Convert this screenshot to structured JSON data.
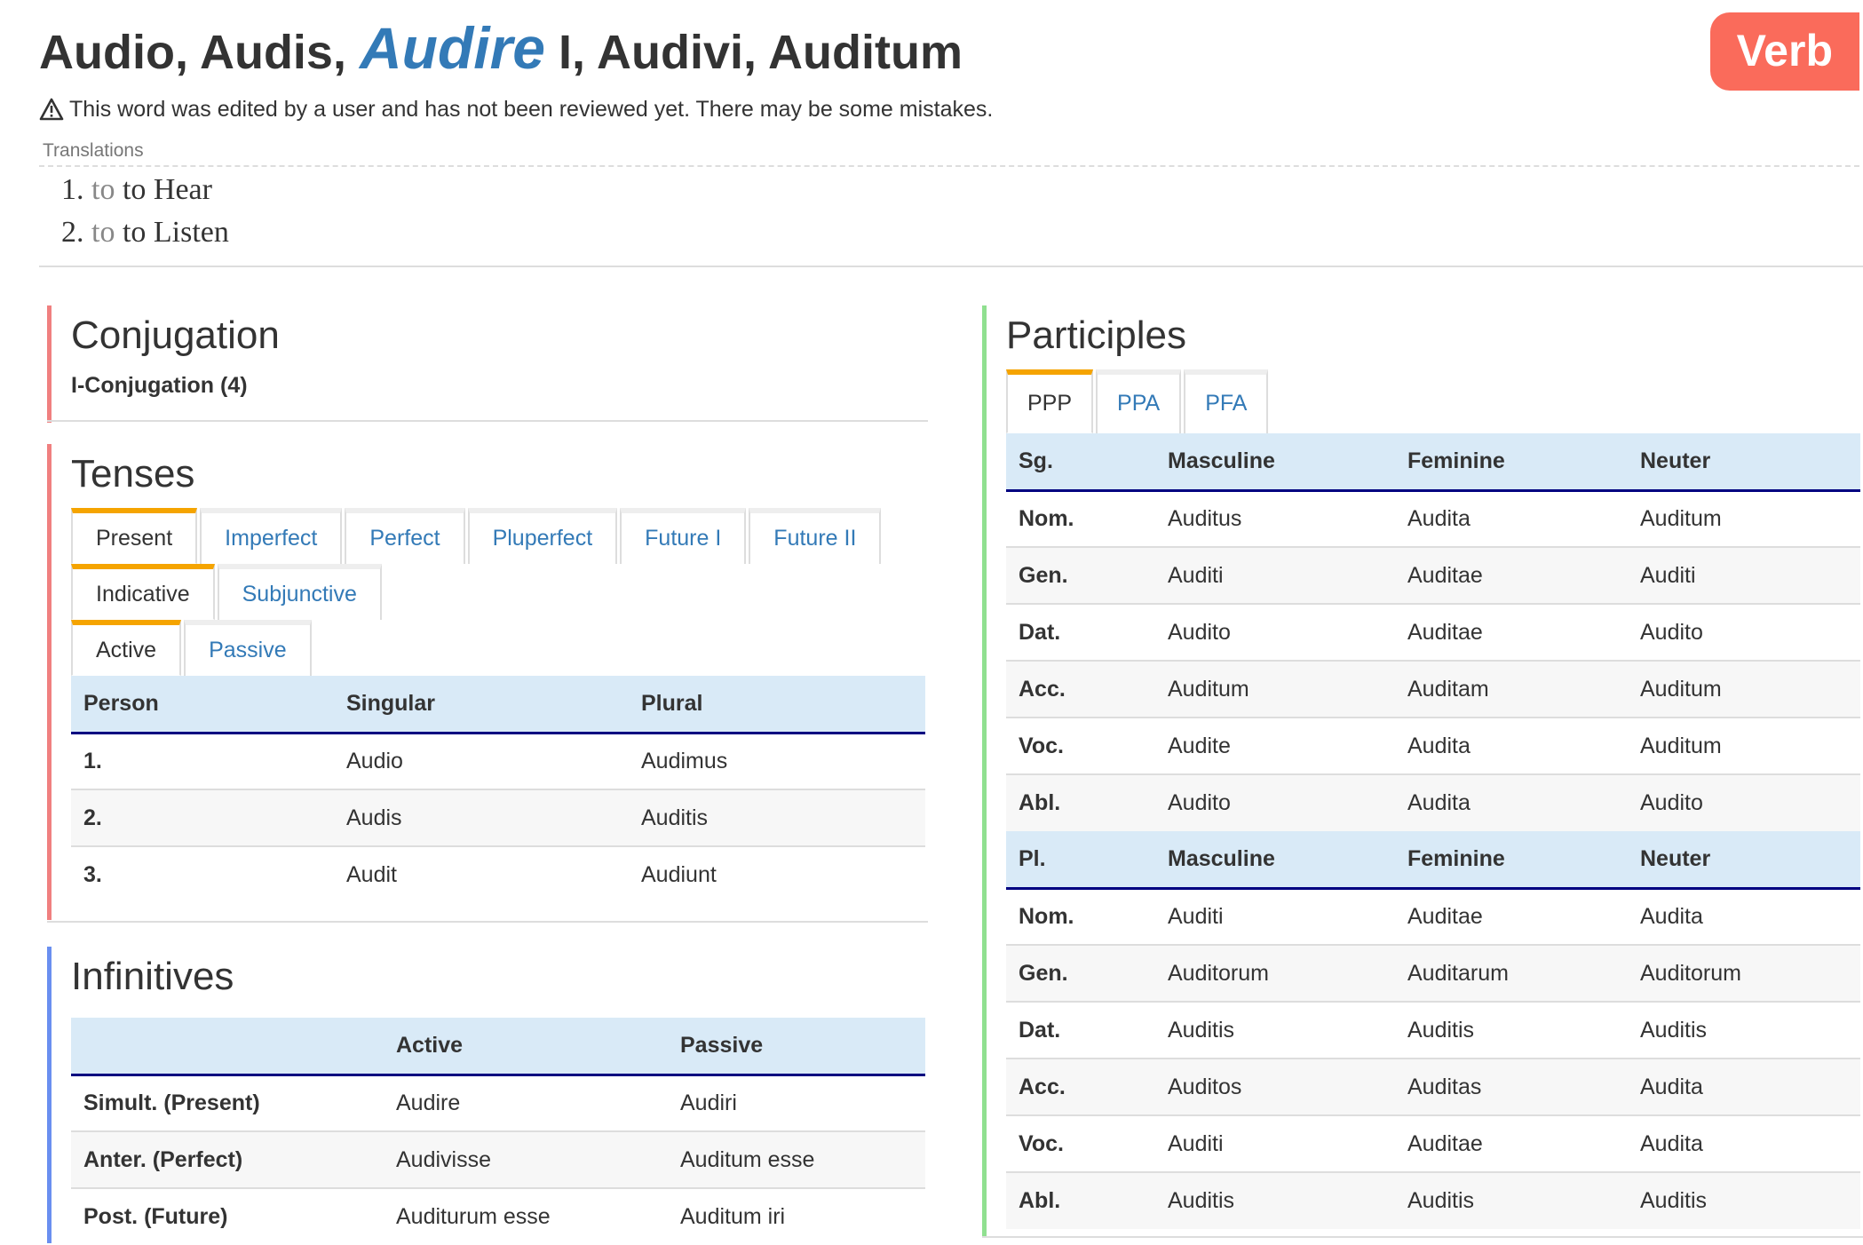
{
  "header": {
    "title_before": "Audio, Audis,",
    "title_highlight": "Audire",
    "title_after": "I, Audivi, Auditum",
    "badge": "Verb",
    "warning": "This word was edited by a user and has not been reviewed yet. There may be some mistakes."
  },
  "translations": {
    "label": "Translations",
    "items": [
      {
        "num": "1.",
        "prefix": "to",
        "text": "to Hear"
      },
      {
        "num": "2.",
        "prefix": "to",
        "text": "to Listen"
      }
    ]
  },
  "conjugation": {
    "heading": "Conjugation",
    "value": "I-Conjugation (4)"
  },
  "tenses": {
    "heading": "Tenses",
    "tense_tabs": [
      "Present",
      "Imperfect",
      "Perfect",
      "Pluperfect",
      "Future I",
      "Future II"
    ],
    "mood_tabs": [
      "Indicative",
      "Subjunctive"
    ],
    "voice_tabs": [
      "Active",
      "Passive"
    ],
    "columns": [
      "Person",
      "Singular",
      "Plural"
    ],
    "rows": [
      [
        "1.",
        "Audio",
        "Audimus"
      ],
      [
        "2.",
        "Audis",
        "Auditis"
      ],
      [
        "3.",
        "Audit",
        "Audiunt"
      ]
    ]
  },
  "infinitives": {
    "heading": "Infinitives",
    "columns": [
      "",
      "Active",
      "Passive"
    ],
    "rows": [
      [
        "Simult. (Present)",
        "Audire",
        "Audiri"
      ],
      [
        "Anter. (Perfect)",
        "Audivisse",
        "Auditum esse"
      ],
      [
        "Post. (Future)",
        "Auditurum esse",
        "Auditum iri"
      ]
    ]
  },
  "participles": {
    "heading": "Participles",
    "tabs": [
      "PPP",
      "PPA",
      "PFA"
    ],
    "singular_header": [
      "Sg.",
      "Masculine",
      "Feminine",
      "Neuter"
    ],
    "singular_rows": [
      [
        "Nom.",
        "Auditus",
        "Audita",
        "Auditum"
      ],
      [
        "Gen.",
        "Auditi",
        "Auditae",
        "Auditi"
      ],
      [
        "Dat.",
        "Audito",
        "Auditae",
        "Audito"
      ],
      [
        "Acc.",
        "Auditum",
        "Auditam",
        "Auditum"
      ],
      [
        "Voc.",
        "Audite",
        "Audita",
        "Auditum"
      ],
      [
        "Abl.",
        "Audito",
        "Audita",
        "Audito"
      ]
    ],
    "plural_header": [
      "Pl.",
      "Masculine",
      "Feminine",
      "Neuter"
    ],
    "plural_rows": [
      [
        "Nom.",
        "Auditi",
        "Auditae",
        "Audita"
      ],
      [
        "Gen.",
        "Auditorum",
        "Auditarum",
        "Auditorum"
      ],
      [
        "Dat.",
        "Auditis",
        "Auditis",
        "Auditis"
      ],
      [
        "Acc.",
        "Auditos",
        "Auditas",
        "Audita"
      ],
      [
        "Voc.",
        "Auditi",
        "Auditae",
        "Audita"
      ],
      [
        "Abl.",
        "Auditis",
        "Auditis",
        "Auditis"
      ]
    ]
  },
  "colors": {
    "accent": "#337ab7",
    "badge": "#fa6b5b",
    "active_tab": "#f5a400",
    "conjugation_bar": "#f08080",
    "infinitives_bar": "#6a8ff0",
    "participles_bar": "#90e090",
    "table_header": "#d9eaf7"
  }
}
